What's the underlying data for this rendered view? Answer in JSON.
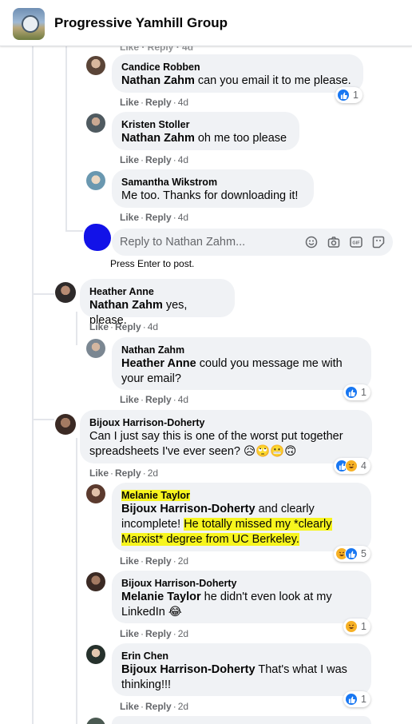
{
  "header": {
    "title": "Progressive Yamhill Group"
  },
  "top_cut_actions": "Like · Reply · 4d",
  "comments": [
    {
      "author": "Candice Robben",
      "mention": "Nathan Zahm",
      "text": " can you email it to me please.",
      "like": "Like",
      "reply": "Reply",
      "time": "4d",
      "reactions": "1"
    },
    {
      "author": "Kristen Stoller",
      "mention": "Nathan Zahm",
      "text": " oh me too please",
      "like": "Like",
      "reply": "Reply",
      "time": "4d"
    },
    {
      "author": "Samantha Wikstrom",
      "text": "Me too. Thanks for downloading it!",
      "like": "Like",
      "reply": "Reply",
      "time": "4d"
    },
    {
      "author": "Heather Anne",
      "mention": "Nathan Zahm",
      "text": " yes, please.",
      "like": "Like",
      "reply": "Reply",
      "time": "4d"
    },
    {
      "author": "Nathan Zahm",
      "mention": "Heather Anne",
      "text_line1": " could you message me with",
      "text_line2": "your email?",
      "like": "Like",
      "reply": "Reply",
      "time": "4d",
      "reactions": "1"
    },
    {
      "author": "Bijoux Harrison-Doherty",
      "text_line1": "Can I just say this is one of the worst put together",
      "text_line2": "spreadsheets I've ever seen? 😥🙄😬🙃",
      "like": "Like",
      "reply": "Reply",
      "time": "2d",
      "reactions": "4"
    },
    {
      "author": "Melanie Taylor",
      "mention": "Bijoux Harrison-Doherty",
      "text_a": " and clearly",
      "text_b": "incomplete! ",
      "text_hl1": "He totally missed my *clearly",
      "text_hl2": "Marxist* degree from UC Berkeley.",
      "like": "Like",
      "reply": "Reply",
      "time": "2d",
      "reactions": "5"
    },
    {
      "author": "Bijoux Harrison-Doherty",
      "mention": "Melanie Taylor",
      "text_line1": " he didn't even look at my",
      "text_line2": "LinkedIn 😂",
      "like": "Like",
      "reply": "Reply",
      "time": "2d",
      "reactions": "1"
    },
    {
      "author": "Erin Chen",
      "mention": "Bijoux Harrison-Doherty",
      "text_line1": " That's what I was",
      "text_line2": "thinking!!!",
      "like": "Like",
      "reply": "Reply",
      "time": "2d",
      "reactions": "1"
    }
  ],
  "reply_box": {
    "placeholder": "Reply to Nathan Zahm...",
    "hint": "Press Enter to post."
  },
  "icons": [
    "group-logo",
    "emoji-icon",
    "camera-icon",
    "gif-icon",
    "sticker-icon",
    "like-reaction-icon",
    "haha-reaction-icon"
  ],
  "colors": {
    "accent": "#1877f2",
    "highlight": "#f7f51e",
    "bubble": "#f0f2f5",
    "meta": "#65676b"
  }
}
